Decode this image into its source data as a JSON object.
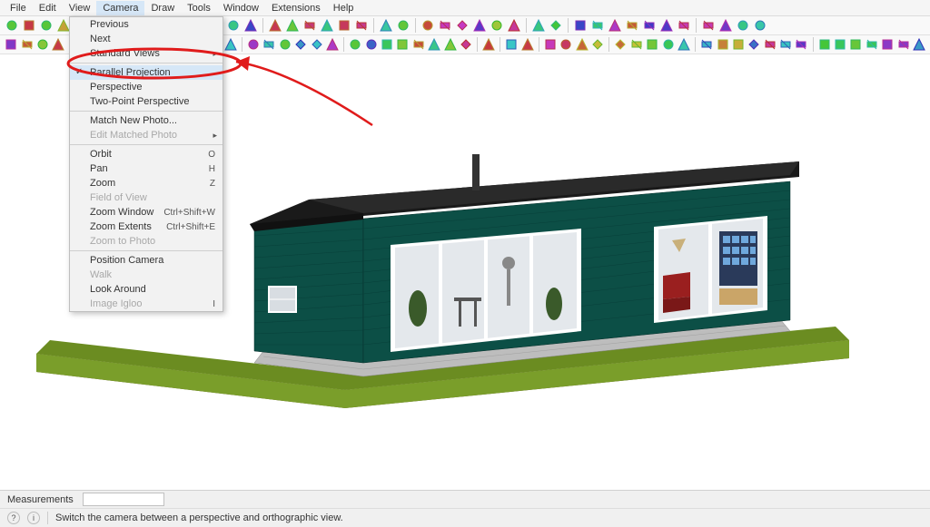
{
  "menubar": [
    "File",
    "Edit",
    "View",
    "Camera",
    "Draw",
    "Tools",
    "Window",
    "Extensions",
    "Help"
  ],
  "menubar_open_index": 3,
  "dropdown": {
    "items": [
      {
        "label": "Previous"
      },
      {
        "label": "Next"
      },
      {
        "label": "Standard Views",
        "submenu": true
      },
      {
        "sep": true
      },
      {
        "label": "Parallel Projection",
        "checked": true,
        "highlight": true
      },
      {
        "label": "Perspective"
      },
      {
        "label": "Two-Point Perspective"
      },
      {
        "sep": true
      },
      {
        "label": "Match New Photo..."
      },
      {
        "label": "Edit Matched Photo",
        "disabled": true,
        "submenu": true
      },
      {
        "sep": true
      },
      {
        "label": "Orbit",
        "shortcut": "O"
      },
      {
        "label": "Pan",
        "shortcut": "H"
      },
      {
        "label": "Zoom",
        "shortcut": "Z"
      },
      {
        "label": "Field of View",
        "disabled": true
      },
      {
        "label": "Zoom Window",
        "shortcut": "Ctrl+Shift+W"
      },
      {
        "label": "Zoom Extents",
        "shortcut": "Ctrl+Shift+E"
      },
      {
        "label": "Zoom to Photo",
        "disabled": true
      },
      {
        "sep": true
      },
      {
        "label": "Position Camera"
      },
      {
        "label": "Walk",
        "disabled": true
      },
      {
        "label": "Look Around"
      },
      {
        "label": "Image Igloo",
        "disabled": true,
        "shortcut": "I"
      }
    ]
  },
  "toolbar1_icons": [
    "new-file",
    "open-file",
    "save",
    "cut",
    "copy",
    "paste",
    "undo",
    "redo",
    "print",
    "model-info",
    "sep",
    "warehouse",
    "extensions",
    "sep",
    "layers",
    "outliner",
    "sep",
    "box-view",
    "wire-view",
    "hidden-line",
    "shaded",
    "textured",
    "monochrome",
    "sep",
    "xray",
    "back-edges",
    "sep",
    "iso",
    "top",
    "front",
    "right",
    "back",
    "left",
    "sep",
    "camera",
    "house",
    "sep",
    "cube",
    "cube-wire",
    "cube-add",
    "cube-del",
    "cube-solid",
    "cube-shaded",
    "cube-blue",
    "sep",
    "gear-blue",
    "gear-plus",
    "gear-minus",
    "gear-refresh"
  ],
  "toolbar2_icons": [
    "search",
    "pointer",
    "hand",
    "eraser",
    "sep",
    "line",
    "arc",
    "rectangle",
    "circle",
    "polygon",
    "sep",
    "pushpull",
    "move",
    "rotate",
    "scale",
    "offset",
    "sep",
    "tape",
    "protractor",
    "dimension",
    "text",
    "axes",
    "section",
    "sep",
    "walk",
    "lookaround",
    "orbit-tool",
    "pan-tool",
    "zoom-tool",
    "zoom-window",
    "zoom-extents",
    "prev-view",
    "sep",
    "position-camera",
    "sep",
    "paint",
    "sample",
    "sep",
    "sandbox-1",
    "sandbox-2",
    "sandbox-3",
    "sandbox-4",
    "sep",
    "solid-1",
    "solid-2",
    "solid-3",
    "solid-4",
    "solid-5",
    "sep",
    "plugin-line",
    "plugin-flag",
    "plugin-rect",
    "plugin-yellow",
    "plugin-ruler",
    "plugin-grad",
    "plugin-bar",
    "sep",
    "plugin-red",
    "plugin-tri",
    "plugin-x",
    "plugin-curve",
    "plugin-s",
    "plugin-box",
    "plugin-dot"
  ],
  "status": {
    "measurements_label": "Measurements",
    "measurements_value": "",
    "help_text": "Switch the camera between a perspective and orthographic view."
  },
  "colors": {
    "siding": "#0c4f46",
    "roof": "#1a1a1a",
    "grass": "#6b8c21",
    "dirt": "#5c4429",
    "concrete": "#bdbdbd",
    "window_frame": "#ffffff",
    "red_chair": "#9a1f1f"
  }
}
